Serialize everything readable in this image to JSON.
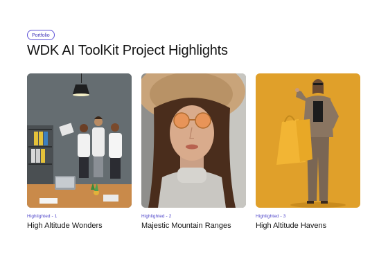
{
  "badge": {
    "label": "Portfolio"
  },
  "header": {
    "title": "WDK AI ToolKit Project Highlights"
  },
  "cards": [
    {
      "subtitle": "Highlighted - 1",
      "title": "High Altitude Wonders",
      "image": "office-team-photo"
    },
    {
      "subtitle": "Highlighted - 2",
      "title": "Majestic Mountain Ranges",
      "image": "woman-sunhat-sunglasses-photo"
    },
    {
      "subtitle": "Highlighted - 3",
      "title": "High Altitude Havens",
      "image": "woman-shopping-bags-photo"
    }
  ],
  "colors": {
    "accent": "#4b42c8",
    "text": "#141414",
    "card3_background": "#e0a02a"
  }
}
